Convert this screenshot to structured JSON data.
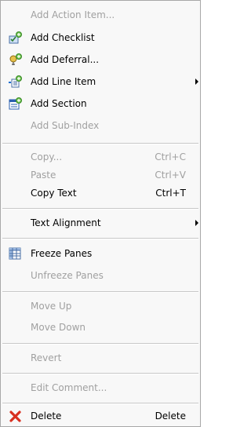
{
  "menu": {
    "items": [
      {
        "label": "Add Action Item...",
        "enabled": false,
        "icon": null
      },
      {
        "label": "Add Checklist",
        "enabled": true,
        "icon": "checklist-icon"
      },
      {
        "label": "Add Deferral...",
        "enabled": true,
        "icon": "deferral-icon"
      },
      {
        "label": "Add Line Item",
        "enabled": true,
        "icon": "line-item-icon",
        "submenu": true
      },
      {
        "label": "Add Section",
        "enabled": true,
        "icon": "section-icon"
      },
      {
        "label": "Add Sub-Index",
        "enabled": false,
        "icon": null
      },
      {
        "label": "Copy...",
        "enabled": false,
        "shortcut": "Ctrl+C"
      },
      {
        "label": "Paste",
        "enabled": false,
        "shortcut": "Ctrl+V"
      },
      {
        "label": "Copy Text",
        "enabled": true,
        "shortcut": "Ctrl+T"
      },
      {
        "label": "Text Alignment",
        "enabled": true,
        "submenu": true
      },
      {
        "label": "Freeze Panes",
        "enabled": true,
        "icon": "freeze-panes-icon"
      },
      {
        "label": "Unfreeze Panes",
        "enabled": false
      },
      {
        "label": "Move Up",
        "enabled": false
      },
      {
        "label": "Move Down",
        "enabled": false
      },
      {
        "label": "Revert",
        "enabled": false
      },
      {
        "label": "Edit Comment...",
        "enabled": false
      },
      {
        "label": "Delete",
        "enabled": true,
        "icon": "delete-icon",
        "shortcut": "Delete"
      }
    ]
  },
  "colors": {
    "enabled_text": "#000000",
    "disabled_text": "#a0a0a0",
    "background": "#f8f8f8"
  }
}
